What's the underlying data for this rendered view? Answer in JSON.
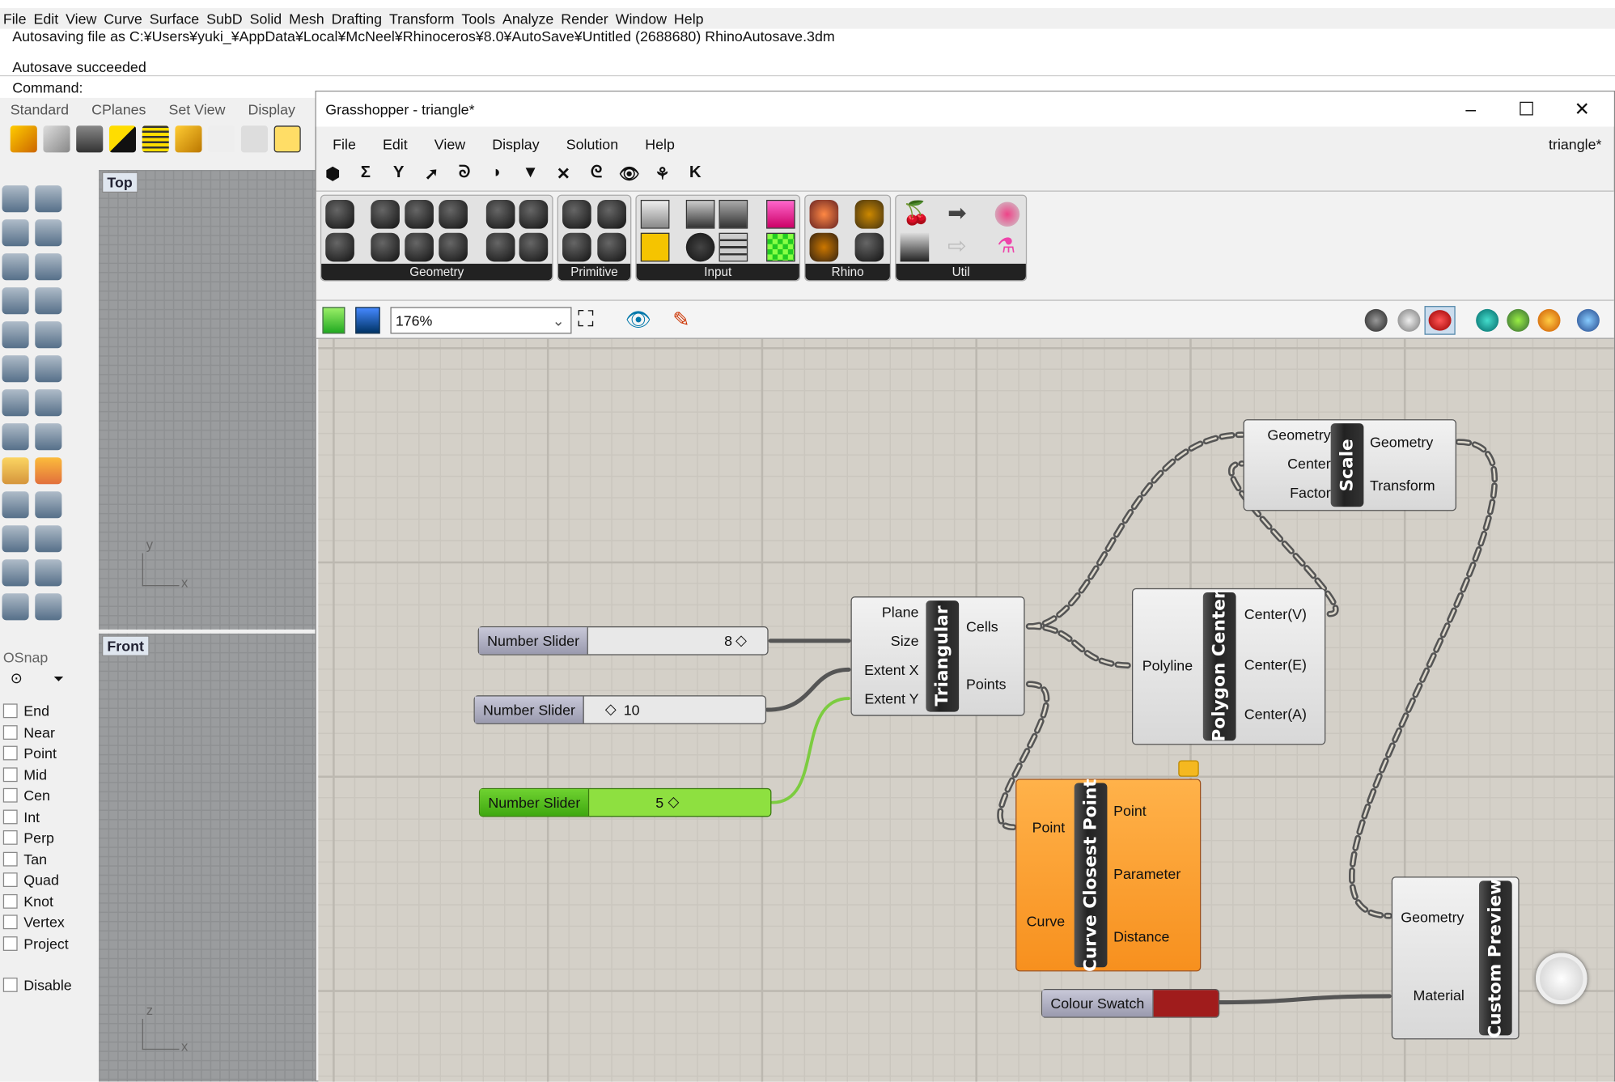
{
  "rhino": {
    "menu": [
      "File",
      "Edit",
      "View",
      "Curve",
      "Surface",
      "SubD",
      "Solid",
      "Mesh",
      "Drafting",
      "Transform",
      "Tools",
      "Analyze",
      "Render",
      "Window",
      "Help"
    ],
    "history": [
      "Autosaving file as C:¥Users¥yuki_¥AppData¥Local¥McNeel¥Rhinoceros¥8.0¥AutoSave¥Untitled (2688680) RhinoAutosave.3dm",
      "Autosave succeeded"
    ],
    "command_label": "Command:",
    "toolbar_tabs": [
      "Standard",
      "CPlanes",
      "Set View",
      "Display"
    ],
    "viewports": {
      "top": "Top",
      "front": "Front",
      "axis_x": "x",
      "axis_y": "y",
      "axis_z": "z"
    },
    "osnap": {
      "title": "OSnap",
      "items": [
        "End",
        "Near",
        "Point",
        "Mid",
        "Cen",
        "Int",
        "Perp",
        "Tan",
        "Quad",
        "Knot",
        "Vertex",
        "Project"
      ],
      "disable": "Disable"
    }
  },
  "gh": {
    "title": "Grasshopper - triangle*",
    "doc_tab": "triangle*",
    "menu": [
      "File",
      "Edit",
      "View",
      "Display",
      "Solution",
      "Help"
    ],
    "tab_icons": [
      "params-icon",
      "maths-icon",
      "sets-icon",
      "vector-icon",
      "curve-icon",
      "surface-icon",
      "mesh-icon",
      "intersect-icon",
      "transform-icon",
      "display-icon",
      "kangaroo-icon",
      "k-icon"
    ],
    "tab_glyphs": [
      "⬢",
      "Σ",
      "Y",
      "➚",
      "ᘐ",
      "◗",
      "▼",
      "✕",
      "ᘓ",
      "👁",
      "⚘",
      "K"
    ],
    "ribbon_groups": [
      "Geometry",
      "Primitive",
      "Input",
      "Rhino",
      "Util"
    ],
    "zoom": "176%",
    "sliders": [
      {
        "label": "Number Slider",
        "value": "8"
      },
      {
        "label": "Number Slider",
        "value": "10"
      },
      {
        "label": "Number Slider",
        "value": "5"
      }
    ],
    "triangular": {
      "name": "Triangular",
      "inputs": [
        "Plane",
        "Size",
        "Extent X",
        "Extent Y"
      ],
      "outputs": [
        "Cells",
        "Points"
      ]
    },
    "polygon_center": {
      "name": "Polygon Center",
      "inputs": [
        "Polyline"
      ],
      "outputs": [
        "Center(V)",
        "Center(E)",
        "Center(A)"
      ]
    },
    "scale": {
      "name": "Scale",
      "inputs": [
        "Geometry",
        "Center",
        "Factor"
      ],
      "outputs": [
        "Geometry",
        "Transform"
      ]
    },
    "curve_closest_point": {
      "name": "Curve Closest Point",
      "inputs": [
        "Point",
        "Curve"
      ],
      "outputs": [
        "Point",
        "Parameter",
        "Distance"
      ]
    },
    "custom_preview": {
      "name": "Custom Preview",
      "inputs": [
        "Geometry",
        "Material"
      ]
    },
    "colour_swatch": {
      "label": "Colour Swatch",
      "color": "#a01c1c"
    },
    "colors": {
      "canvas": "#d4d0c8",
      "component_warning": "#f7901e",
      "slider_selected": "#8ee040"
    }
  }
}
